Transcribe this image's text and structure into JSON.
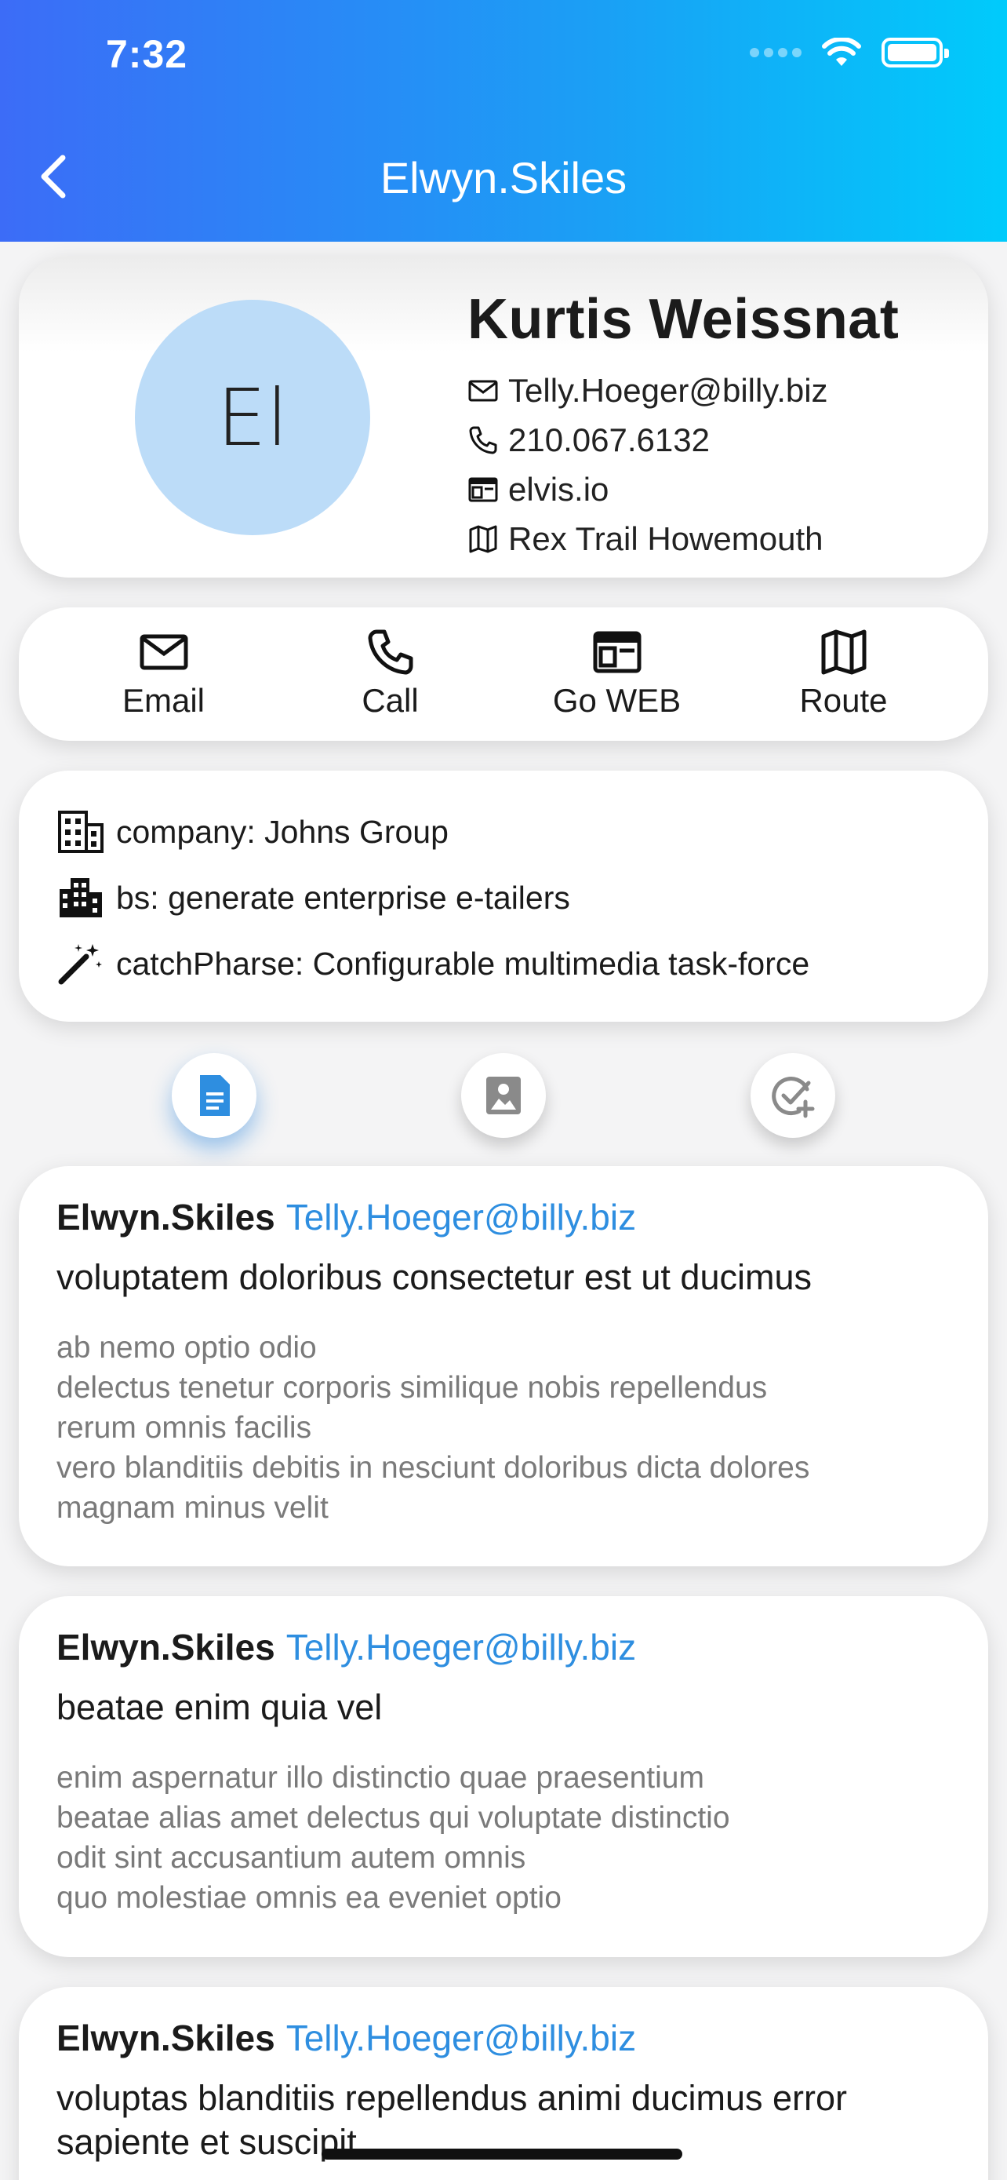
{
  "status_bar": {
    "time": "7:32"
  },
  "nav": {
    "title": "Elwyn.Skiles"
  },
  "profile": {
    "initials": "El",
    "name": "Kurtis Weissnat",
    "email": "Telly.Hoeger@billy.biz",
    "phone": "210.067.6132",
    "website": "elvis.io",
    "address": "Rex Trail Howemouth"
  },
  "actions": [
    {
      "label": "Email",
      "icon": "mail-icon"
    },
    {
      "label": "Call",
      "icon": "phone-icon"
    },
    {
      "label": "Go WEB",
      "icon": "browser-icon"
    },
    {
      "label": "Route",
      "icon": "map-icon"
    }
  ],
  "company": {
    "company": "company: Johns Group",
    "bs": "bs: generate enterprise e-tailers",
    "catch_phrase": "catchPharse: Configurable multimedia task-force"
  },
  "tabs": [
    {
      "icon": "document-icon",
      "active": true
    },
    {
      "icon": "photo-icon",
      "active": false
    },
    {
      "icon": "todo-check-add-icon",
      "active": false
    }
  ],
  "colors": {
    "accent": "#2e8ee0",
    "header_start": "#3c6cf7",
    "header_end": "#00cbfb",
    "avatar_bg": "#bcdcf8"
  },
  "posts": [
    {
      "user": "Elwyn.Skiles",
      "email": "Telly.Hoeger@billy.biz",
      "title": "voluptatem doloribus consectetur est ut ducimus",
      "body": "ab nemo optio odio\ndelectus tenetur corporis similique nobis repellendus\nrerum omnis facilis\nvero blanditiis debitis in nesciunt doloribus dicta dolores\nmagnam minus velit"
    },
    {
      "user": "Elwyn.Skiles",
      "email": "Telly.Hoeger@billy.biz",
      "title": "beatae enim quia vel",
      "body": "enim aspernatur illo distinctio quae praesentium\nbeatae alias amet delectus qui voluptate distinctio\nodit sint accusantium autem omnis\nquo molestiae omnis ea eveniet optio"
    },
    {
      "user": "Elwyn.Skiles",
      "email": "Telly.Hoeger@billy.biz",
      "title": "voluptas blanditiis repellendus animi ducimus error sapiente et suscipit",
      "body": ""
    }
  ]
}
